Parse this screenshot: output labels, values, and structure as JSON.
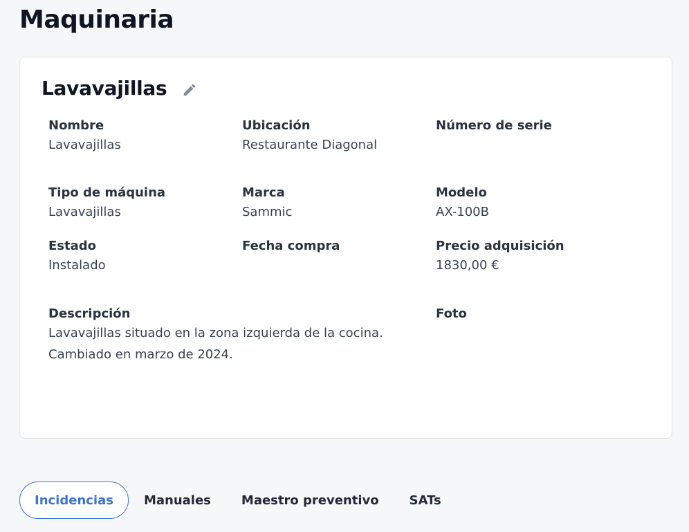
{
  "page": {
    "title": "Maquinaria"
  },
  "card": {
    "title": "Lavavajillas",
    "fields": {
      "nombre": {
        "label": "Nombre",
        "value": "Lavavajillas"
      },
      "ubicacion": {
        "label": "Ubicación",
        "value": "Restaurante Diagonal"
      },
      "numero_serie": {
        "label": "Número de serie",
        "value": ""
      },
      "tipo_maquina": {
        "label": "Tipo de máquina",
        "value": "Lavavajillas"
      },
      "marca": {
        "label": "Marca",
        "value": "Sammic"
      },
      "modelo": {
        "label": "Modelo",
        "value": "AX-100B"
      },
      "estado": {
        "label": "Estado",
        "value": "Instalado"
      },
      "fecha_compra": {
        "label": "Fecha compra",
        "value": ""
      },
      "precio": {
        "label": "Precio adquisición",
        "value": "1830,00 €"
      },
      "descripcion": {
        "label": "Descripción",
        "value_line1": "Lavavajillas situado en la zona izquierda de la cocina.",
        "value_line2": "Cambiado en marzo de 2024."
      },
      "foto": {
        "label": "Foto"
      }
    }
  },
  "tabs": [
    {
      "label": "Incidencias",
      "active": true
    },
    {
      "label": "Manuales",
      "active": false
    },
    {
      "label": "Maestro preventivo",
      "active": false
    },
    {
      "label": "SATs",
      "active": false
    }
  ],
  "icons": {
    "edit": "pencil-icon"
  },
  "colors": {
    "accent": "#3b74d6",
    "icon": "#7f8896"
  }
}
